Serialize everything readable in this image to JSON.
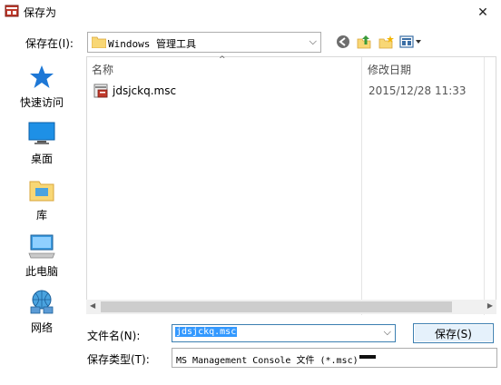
{
  "window": {
    "title": "保存为",
    "close_symbol": "✕",
    "icon": "msc-console-icon"
  },
  "savein": {
    "label": "保存在(I):",
    "value": "Windows 管理工具",
    "dropdown_symbol": "⌵"
  },
  "toolbar": {
    "back_icon": "back-arrow-icon",
    "up_icon": "up-folder-icon",
    "new_folder_icon": "new-folder-icon",
    "view_icon": "view-menu-icon"
  },
  "places": [
    {
      "label": "快速访问",
      "icon": "star-icon"
    },
    {
      "label": "桌面",
      "icon": "desktop-icon"
    },
    {
      "label": "库",
      "icon": "library-icon"
    },
    {
      "label": "此电脑",
      "icon": "computer-icon"
    },
    {
      "label": "网络",
      "icon": "network-icon"
    }
  ],
  "filelist": {
    "columns": [
      "名称",
      "修改日期"
    ],
    "sort_symbol": "^",
    "files": [
      {
        "name": "jdsjckq.msc",
        "modified": "2015/12/28 11:33",
        "icon": "msc-file-icon"
      }
    ]
  },
  "filename": {
    "label": "文件名(N):",
    "value": "jdsjckq.msc",
    "dropdown_symbol": "⌵"
  },
  "filetype": {
    "label": "保存类型(T):",
    "value": "MS Management Console 文件 (*.msc)"
  },
  "buttons": {
    "save": "保存(S)"
  },
  "colors": {
    "accent": "#3399ff",
    "button_border": "#3c7fb1",
    "button_bg": "#e5f1fb"
  }
}
